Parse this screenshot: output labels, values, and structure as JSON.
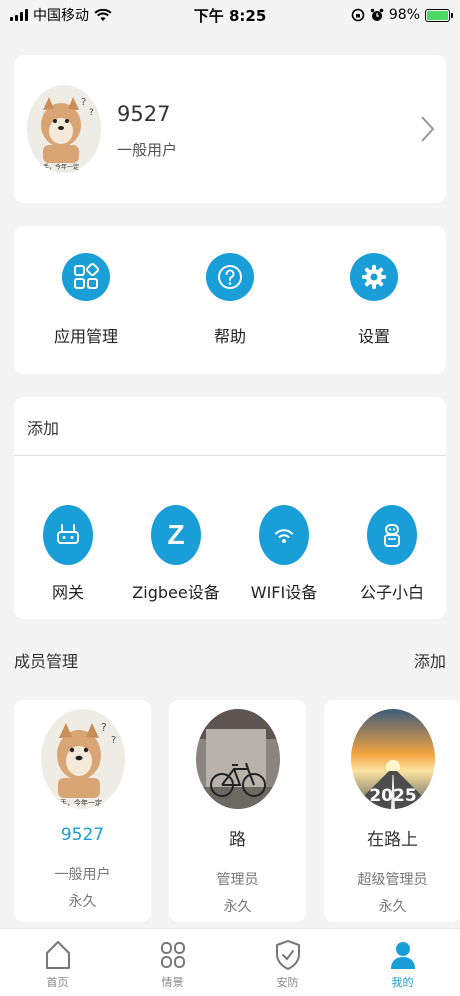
{
  "status_bar": {
    "carrier": "中国移动",
    "time": "下午 8:25",
    "battery": "98%"
  },
  "profile": {
    "name": "9527",
    "role": "一般用户",
    "avatar_caption": "未松手，今年一定"
  },
  "shortcuts": [
    {
      "label": "应用管理",
      "icon": "apps-grid-icon"
    },
    {
      "label": "帮助",
      "icon": "help-icon"
    },
    {
      "label": "设置",
      "icon": "gear-icon"
    }
  ],
  "add_section": {
    "title": "添加",
    "devices": [
      {
        "label": "网关",
        "icon": "gateway-icon"
      },
      {
        "label": "Zigbee设备",
        "icon": "zigbee-icon",
        "glyph": "Z"
      },
      {
        "label": "WIFI设备",
        "icon": "wifi-icon"
      },
      {
        "label": "公子小白",
        "icon": "robot-icon"
      }
    ]
  },
  "members_section": {
    "title": "成员管理",
    "add_label": "添加",
    "members": [
      {
        "name": "9527",
        "role": "一般用户",
        "term": "永久"
      },
      {
        "name": "路",
        "role": "管理员",
        "term": "永久"
      },
      {
        "name": "在路上",
        "role": "超级管理员",
        "term": "永久",
        "avatar_text": "2025"
      }
    ]
  },
  "tabs": [
    {
      "label": "首页",
      "icon": "home-icon"
    },
    {
      "label": "情景",
      "icon": "scene-icon"
    },
    {
      "label": "安防",
      "icon": "shield-icon"
    },
    {
      "label": "我的",
      "icon": "user-icon",
      "active": true
    }
  ],
  "colors": {
    "accent": "#1a9ed8",
    "background": "#f4f4f4",
    "card": "#ffffff"
  }
}
